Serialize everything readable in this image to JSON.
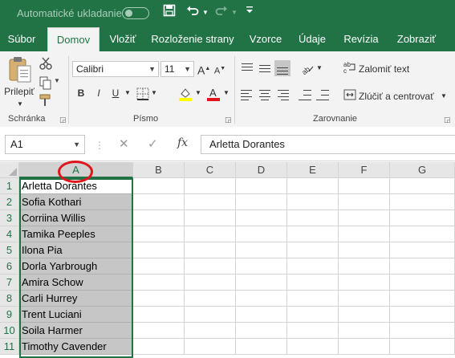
{
  "titlebar": {
    "autosave_label": "Automatické ukladanie",
    "icons": [
      "save-icon",
      "undo-icon",
      "redo-icon",
      "customize-quick-access-icon"
    ]
  },
  "tabs": [
    {
      "label": "Súbor"
    },
    {
      "label": "Domov",
      "active": true
    },
    {
      "label": "Vložiť"
    },
    {
      "label": "Rozloženie strany"
    },
    {
      "label": "Vzorce"
    },
    {
      "label": "Údaje"
    },
    {
      "label": "Revízia"
    },
    {
      "label": "Zobraziť"
    }
  ],
  "ribbon": {
    "clipboard": {
      "paste_label": "Prilepiť",
      "group_label": "Schránka"
    },
    "font": {
      "name": "Calibri",
      "size": "11",
      "group_label": "Písmo",
      "bold": "B",
      "italic": "I",
      "underline": "U"
    },
    "alignment": {
      "wrap_text": "Zalomiť text",
      "merge_center": "Zlúčiť a centrovať",
      "group_label": "Zarovnanie"
    }
  },
  "formula_bar": {
    "name_box": "A1",
    "fx": "fx",
    "value": "Arletta Dorantes"
  },
  "grid": {
    "columns": [
      "A",
      "B",
      "C",
      "D",
      "E",
      "F",
      "G"
    ],
    "selected_column": "A",
    "rows": [
      {
        "num": "1",
        "a": "Arletta Dorantes"
      },
      {
        "num": "2",
        "a": "Sofia Kothari"
      },
      {
        "num": "3",
        "a": "Corriina Willis"
      },
      {
        "num": "4",
        "a": "Tamika Peeples"
      },
      {
        "num": "5",
        "a": "Ilona Pia"
      },
      {
        "num": "6",
        "a": "Dorla Yarbrough"
      },
      {
        "num": "7",
        "a": "Amira Schow"
      },
      {
        "num": "8",
        "a": "Carli Hurrey"
      },
      {
        "num": "9",
        "a": "Trent Luciani"
      },
      {
        "num": "10",
        "a": "Soila Harmer"
      },
      {
        "num": "11",
        "a": "Timothy Cavender"
      }
    ]
  },
  "colors": {
    "excel_green": "#217346",
    "selection_gray": "#c6c6c6",
    "annotation_red": "#e0151c"
  }
}
